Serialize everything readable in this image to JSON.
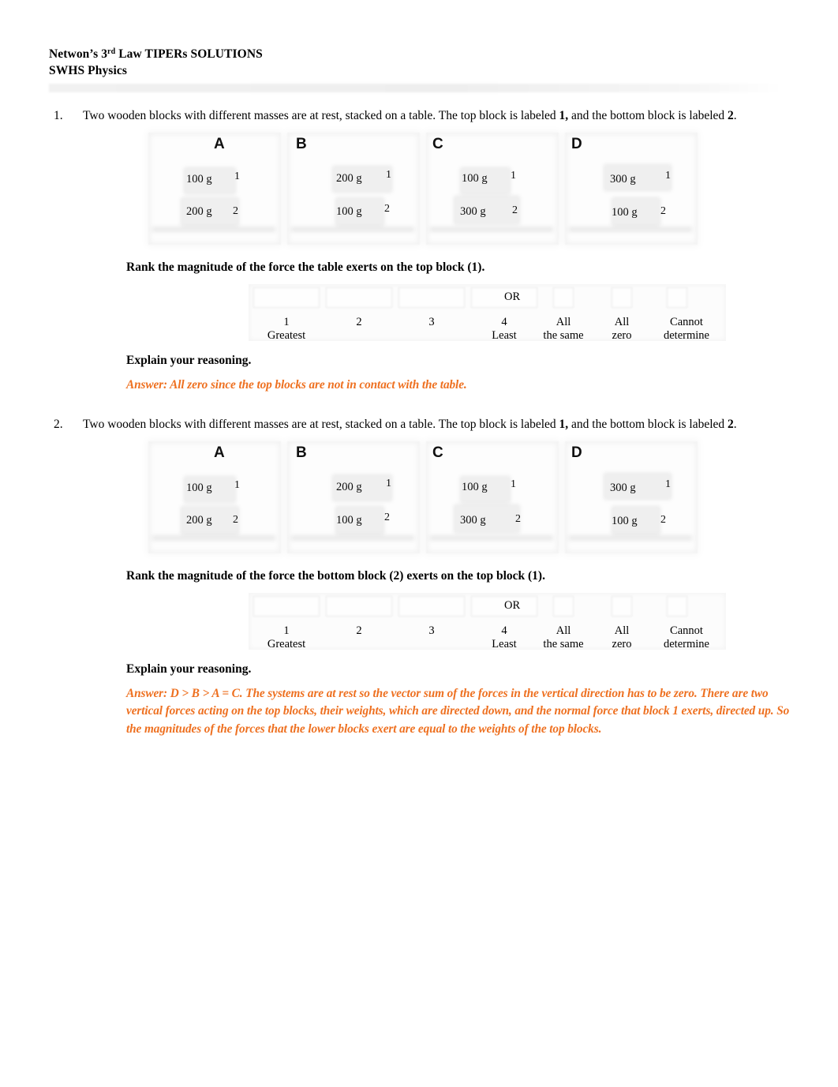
{
  "header": {
    "title_prefix": "Netwon’s 3",
    "title_sup": "rd",
    "title_suffix": " Law TIPERs SOLUTIONS",
    "subtitle": "SWHS Physics"
  },
  "theme": {
    "answer_color": "#ee7020",
    "text_color": "#000000",
    "page_background": "#ffffff"
  },
  "questions": [
    {
      "number": "1.",
      "stem_part1": "Two wooden blocks with different masses are at rest, stacked on a table. The top block is labeled ",
      "stem_bold1": "1,",
      "stem_part2": " and the bottom block is labeled ",
      "stem_bold2": "2",
      "stem_part3": ".",
      "panels": [
        {
          "letter": "A",
          "top_mass": "100 g",
          "top_index": "1",
          "bottom_mass": "200 g",
          "bottom_index": "2"
        },
        {
          "letter": "B",
          "top_mass": "200 g",
          "top_index": "1",
          "bottom_mass": "100 g",
          "bottom_index": "2"
        },
        {
          "letter": "C",
          "top_mass": "100 g",
          "top_index": "1",
          "bottom_mass": "300 g",
          "bottom_index": "2"
        },
        {
          "letter": "D",
          "top_mass": "300 g",
          "top_index": "1",
          "bottom_mass": "100 g",
          "bottom_index": "2"
        }
      ],
      "prompt": "Rank the magnitude of the force the table exerts on the top block (1).",
      "scale": {
        "or_label": "OR",
        "ranks": [
          {
            "top": "1",
            "bottom": "Greatest"
          },
          {
            "top": "2",
            "bottom": ""
          },
          {
            "top": "3",
            "bottom": ""
          },
          {
            "top": "4",
            "bottom": "Least"
          }
        ],
        "options": [
          {
            "top": "All",
            "bottom": "the same"
          },
          {
            "top": "All",
            "bottom": "zero"
          },
          {
            "top": "Cannot",
            "bottom": "determine"
          }
        ]
      },
      "explain_label": "Explain your reasoning.",
      "answer": "Answer: All zero since the top blocks are not in contact with the table."
    },
    {
      "number": "2.",
      "stem_part1": "Two wooden blocks with different masses are at rest, stacked on a table. The top block is labeled ",
      "stem_bold1": "1,",
      "stem_part2": " and the bottom block is labeled ",
      "stem_bold2": "2",
      "stem_part3": ".",
      "panels": [
        {
          "letter": "A",
          "top_mass": "100 g",
          "top_index": "1",
          "bottom_mass": "200 g",
          "bottom_index": "2"
        },
        {
          "letter": "B",
          "top_mass": "200 g",
          "top_index": "1",
          "bottom_mass": "100 g",
          "bottom_index": "2"
        },
        {
          "letter": "C",
          "top_mass": "100 g",
          "top_index": "1",
          "bottom_mass": "300 g",
          "bottom_index": "2"
        },
        {
          "letter": "D",
          "top_mass": "300 g",
          "top_index": "1",
          "bottom_mass": "100 g",
          "bottom_index": "2"
        }
      ],
      "prompt": "Rank the magnitude of the force the bottom block (2) exerts on the top block (1).",
      "scale": {
        "or_label": "OR",
        "ranks": [
          {
            "top": "1",
            "bottom": "Greatest"
          },
          {
            "top": "2",
            "bottom": ""
          },
          {
            "top": "3",
            "bottom": ""
          },
          {
            "top": "4",
            "bottom": "Least"
          }
        ],
        "options": [
          {
            "top": "All",
            "bottom": "the same"
          },
          {
            "top": "All",
            "bottom": "zero"
          },
          {
            "top": "Cannot",
            "bottom": "determine"
          }
        ]
      },
      "explain_label": "Explain your reasoning.",
      "answer": "Answer: D > B > A = C. The systems are at rest so the vector sum of the forces in the vertical direction has to be zero. There are two vertical forces acting on the top blocks, their weights, which are directed down, and the normal force that block 1 exerts, directed up. So the magnitudes of the forces that the lower blocks exert are equal to the weights of the top blocks."
    }
  ]
}
